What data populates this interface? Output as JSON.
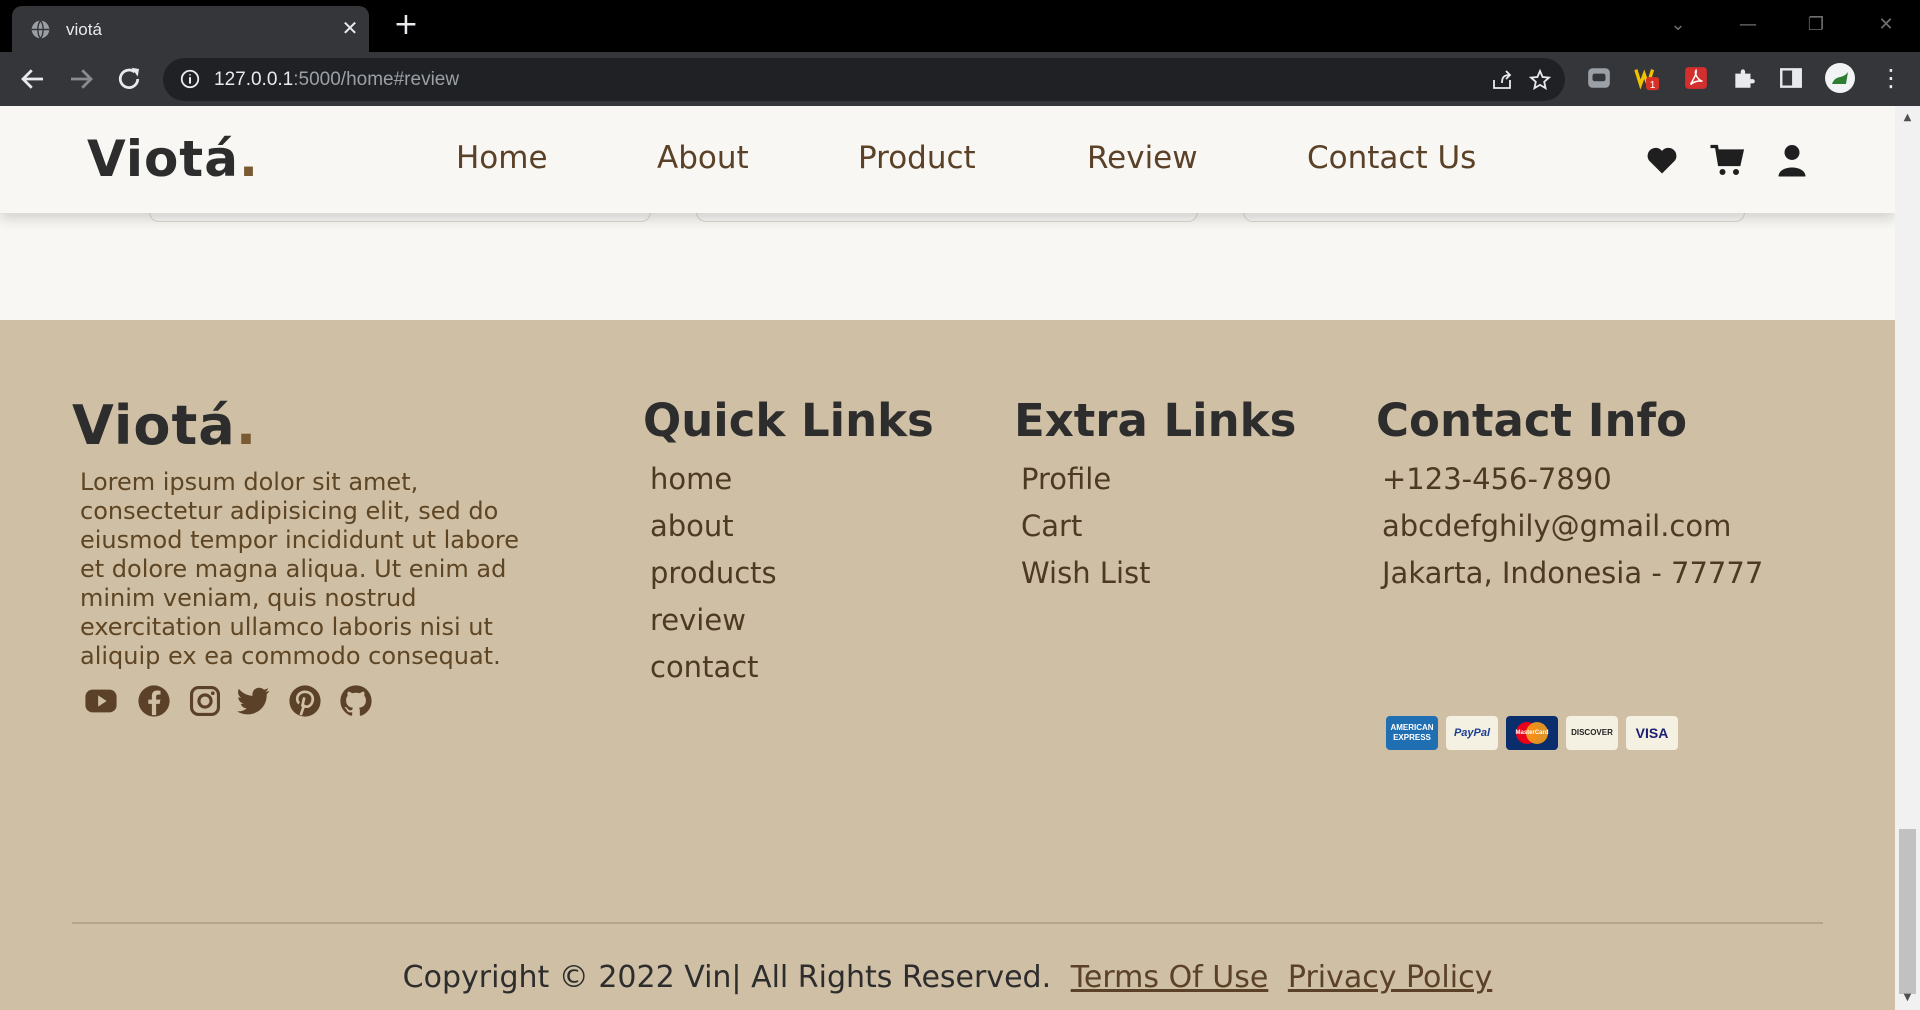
{
  "browser": {
    "tab_title": "viotá",
    "url_host": "127.0.0.1",
    "url_rest": ":5000/home#review",
    "extension_badge": "1"
  },
  "header": {
    "logo_text": "Viotá",
    "logo_dot": ".",
    "nav": [
      "Home",
      "About",
      "Product",
      "Review",
      "Contact Us"
    ]
  },
  "footer": {
    "logo_text": "Viotá",
    "logo_dot": ".",
    "description": "Lorem ipsum dolor sit amet, consectetur adipisicing elit, sed do eiusmod tempor incididunt ut labore et dolore magna aliqua. Ut enim ad minim veniam, quis nostrud exercitation ullamco laboris nisi ut aliquip ex ea commodo consequat.",
    "quick_links": {
      "title": "Quick Links",
      "items": [
        "home",
        "about",
        "products",
        "review",
        "contact"
      ]
    },
    "extra_links": {
      "title": "Extra Links",
      "items": [
        "Profile",
        "Cart",
        "Wish List"
      ]
    },
    "contact_info": {
      "title": "Contact Info",
      "phone": "+123-456-7890",
      "email": "abcdefghily@gmail.com",
      "address": "Jakarta, Indonesia - 77777"
    },
    "payment_cards": [
      "AMERICAN EXPRESS",
      "PayPal",
      "MasterCard",
      "DISCOVER",
      "VISA"
    ],
    "copyright_text": "Copyright © 2022 Vin| All Rights Reserved.",
    "terms_label": "Terms Of Use",
    "privacy_label": "Privacy Policy"
  },
  "colors": {
    "page_bg": "#f8f7f3",
    "footer_bg": "#cfbfa5",
    "accent": "#7a5a32",
    "text_dark": "#2d2d2d"
  }
}
